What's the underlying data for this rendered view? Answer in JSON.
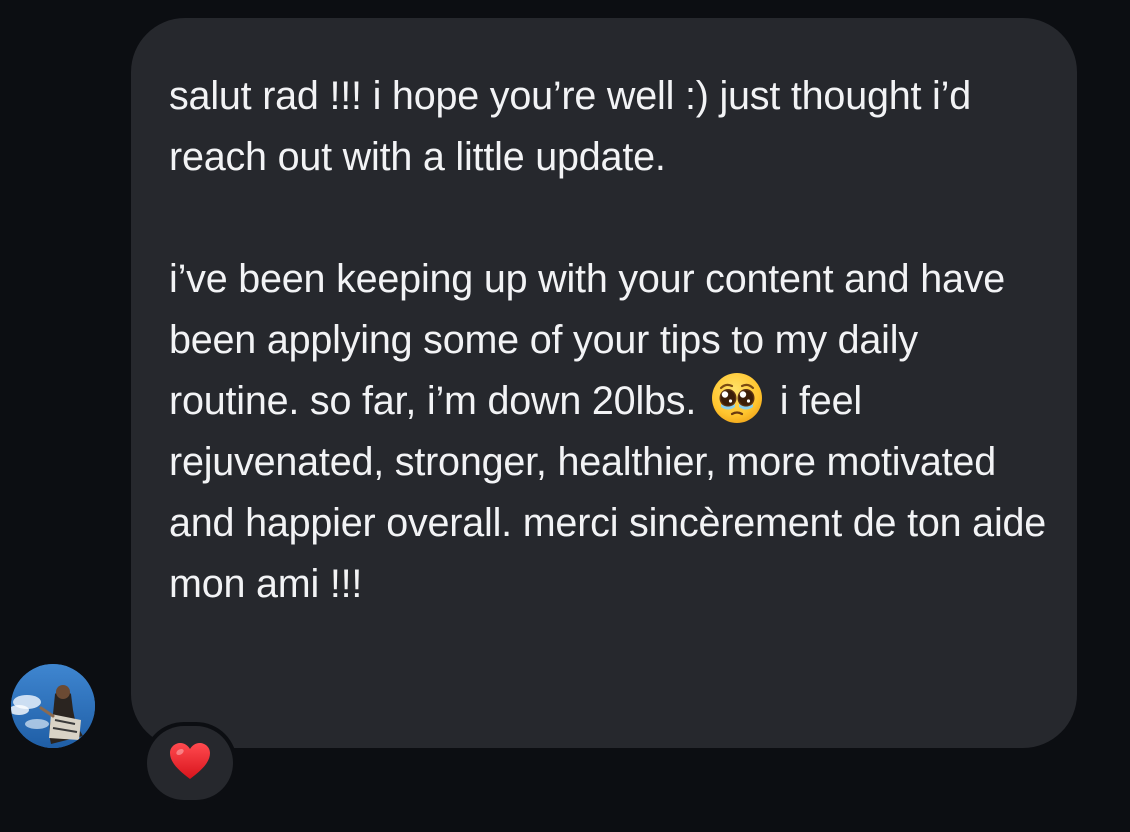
{
  "message": {
    "paragraph_1": "salut rad !!! i hope you’re well :) just thought i’d reach out with a little update.",
    "paragraph_2_before_emoji": "i’ve been keeping up with your content and have been applying some of your tips to my daily routine. so far, i’m down 20lbs.",
    "emoji": "pleading-face-with-tears-icon",
    "paragraph_2_after_emoji": "i feel rejuvenated, stronger, healthier, more motivated and happier overall. merci sincèrement de ton aide mon ami !!!"
  },
  "reaction": {
    "icon": "red-heart-icon"
  },
  "sender": {
    "avatar": "avatar-photo"
  },
  "colors": {
    "background": "#0c0e12",
    "bubble": "#26282d",
    "text": "#f2f3f5",
    "heart": "#e8282f"
  }
}
